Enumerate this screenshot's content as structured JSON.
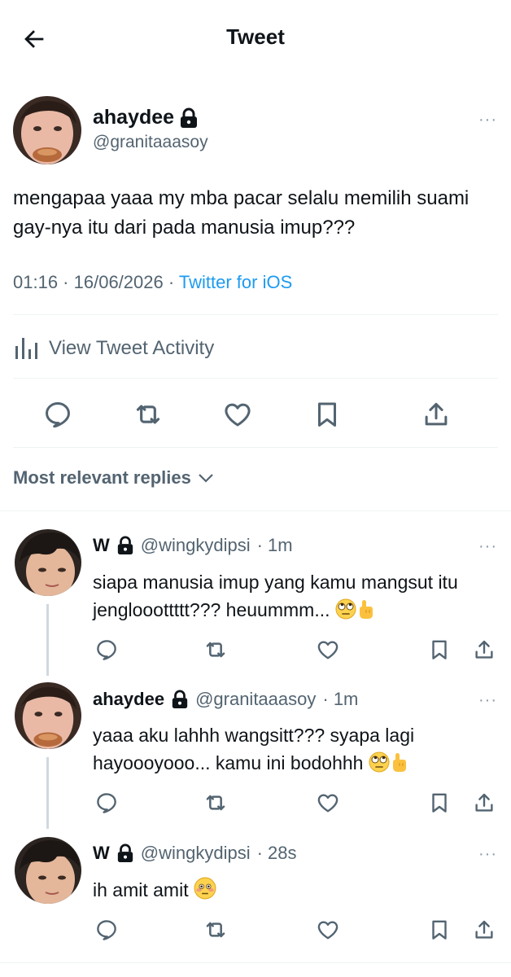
{
  "header": {
    "title": "Tweet"
  },
  "main_tweet": {
    "name": "ahaydee",
    "handle": "@granitaaasoy",
    "text": "mengapaa yaaa my mba pacar selalu memilih suami gay-nya itu dari pada manusia imup???",
    "time": "01:16",
    "separator": " · ",
    "date": "16/06/2026",
    "source": "Twitter for iOS",
    "more": "···"
  },
  "activity": {
    "label": "View Tweet Activity"
  },
  "replies_header": {
    "label": "Most relevant replies"
  },
  "replies": [
    {
      "name": "W",
      "handle": "@wingkydipsi",
      "time": "· 1m",
      "text": "siapa manusia imup yang kamu mangsut itu jenglooottttt??? heuummm...",
      "emojis": [
        "face-with-rolling-eyes",
        "index-pointing-up"
      ]
    },
    {
      "name": "ahaydee",
      "handle": "@granitaaasoy",
      "time": "· 1m",
      "text": "yaaa aku lahhh wangsitt??? syapa lagi hayoooyooo... kamu ini bodohhh",
      "emojis": [
        "face-with-rolling-eyes",
        "index-pointing-up"
      ]
    },
    {
      "name": "W",
      "handle": "@wingkydipsi",
      "time": "· 28s",
      "text": "ih amit amit",
      "emojis": [
        "flushed-face"
      ]
    }
  ],
  "colors": {
    "text": "#0f1419",
    "secondary": "#536471",
    "link": "#1d9bf0",
    "divider": "#eff3f4",
    "thread_line": "#cfd9de"
  }
}
